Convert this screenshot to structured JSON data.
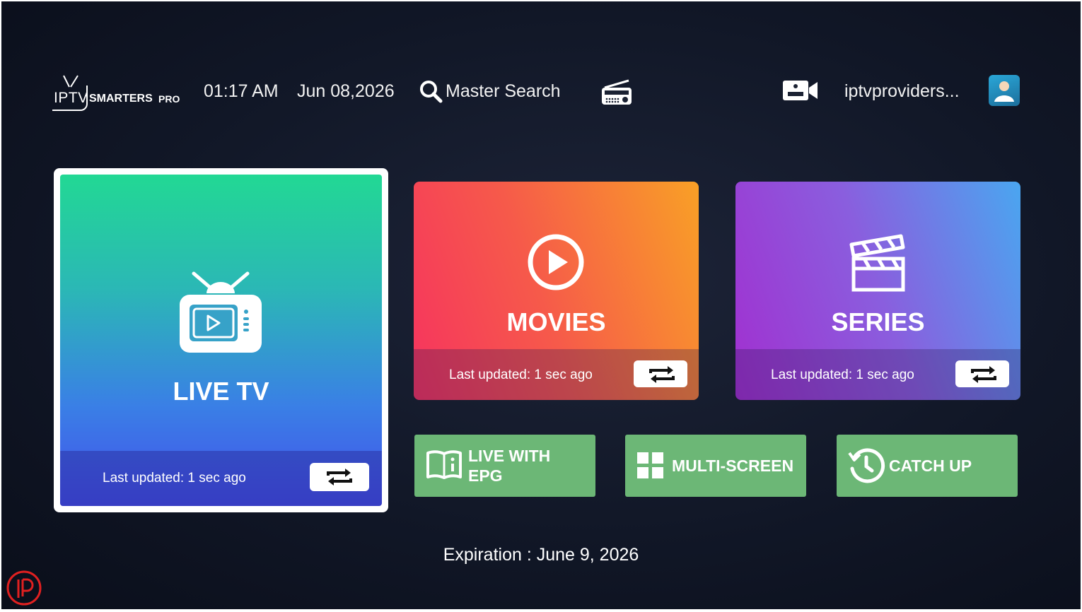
{
  "header": {
    "logo": {
      "iptv": "IPTV",
      "smarters": "SMARTERS",
      "pro": "PRO"
    },
    "time": "01:17 AM",
    "date": "Jun 08,2026",
    "search_label": "Master Search",
    "username": "iptvproviders..."
  },
  "tiles": {
    "live_tv": {
      "title": "LIVE TV",
      "last_updated": "Last updated: 1 sec ago"
    },
    "movies": {
      "title": "MOVIES",
      "last_updated": "Last updated: 1 sec ago"
    },
    "series": {
      "title": "SERIES",
      "last_updated": "Last updated: 1 sec ago"
    }
  },
  "buttons": {
    "live_with_epg": {
      "line1": "LIVE WITH",
      "line2": "EPG"
    },
    "multi_screen": "MULTI-SCREEN",
    "catch_up": "CATCH UP"
  },
  "expiration": "Expiration : June 9, 2026",
  "colors": {
    "live_gradient": [
      "#22d894",
      "#4450ea"
    ],
    "movies_gradient": [
      "#f6335f",
      "#f9a026"
    ],
    "series_gradient": [
      "#a12fd0",
      "#4aa6f0"
    ],
    "button_green": "#6cb776"
  },
  "icons": [
    "tv-icon",
    "play-circle-icon",
    "clapperboard-icon",
    "search-icon",
    "radio-icon",
    "record-camera-icon",
    "avatar-icon",
    "refresh-icon",
    "book-info-icon",
    "grid-icon",
    "history-clock-icon"
  ]
}
